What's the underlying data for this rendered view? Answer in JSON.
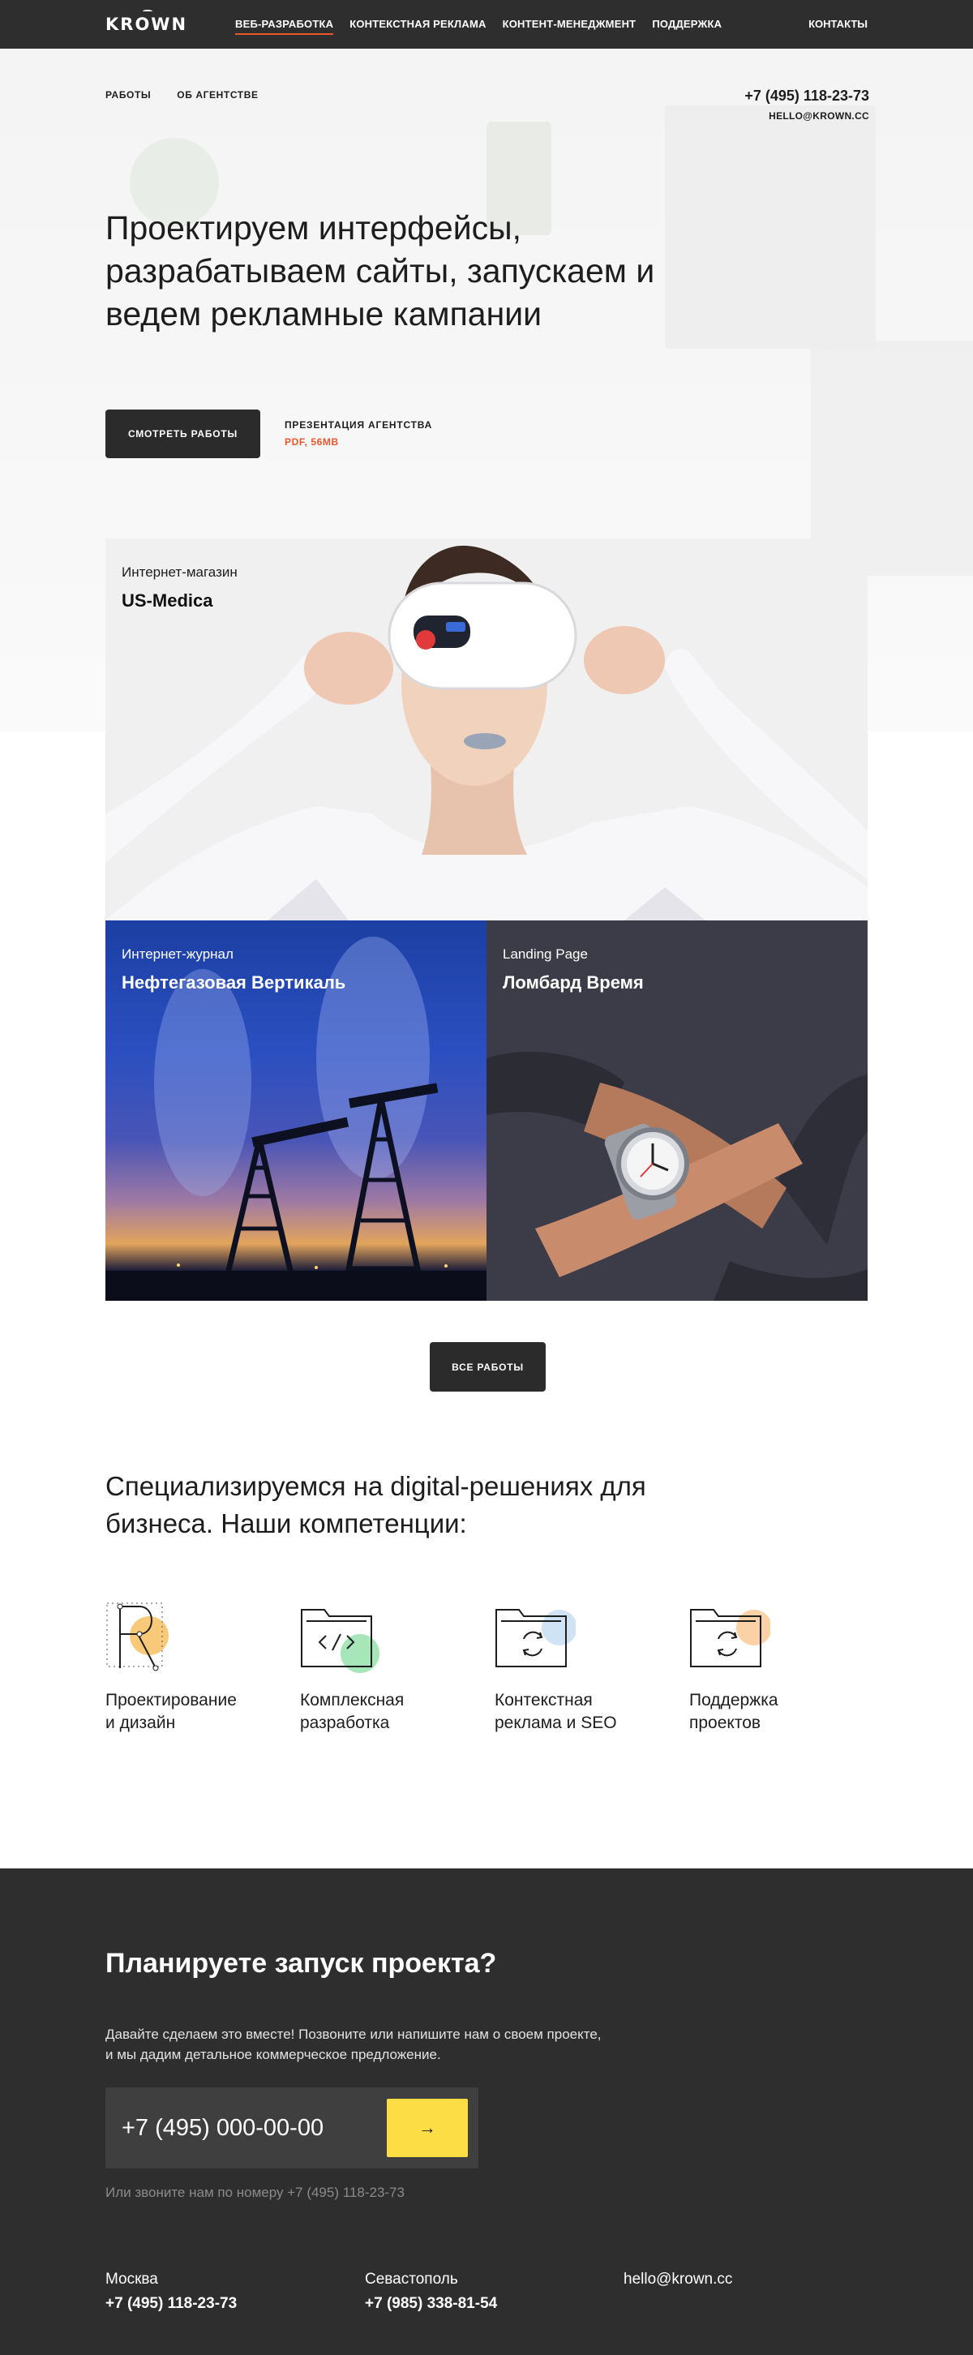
{
  "header": {
    "logo": "KROWN",
    "nav": [
      {
        "label": "ВЕБ-РАЗРАБОТКА",
        "active": true
      },
      {
        "label": "КОНТЕКСТНАЯ РЕКЛАМА"
      },
      {
        "label": "КОНТЕНТ-МЕНЕДЖМЕНТ"
      },
      {
        "label": "ПОДДЕРЖКА"
      }
    ],
    "contacts_label": "КОНТАКТЫ"
  },
  "hero": {
    "subnav": [
      "РАБОТЫ",
      "ОБ АГЕНТСТВЕ"
    ],
    "phone": "+7 (495) 118-23-73",
    "email": "HELLO@KROWN.CC",
    "title": "Проектируем интерфейсы, разрабатываем сайты, запускаем и ведем рекламные кампании",
    "works_button": "СМОТРЕТЬ РАБОТЫ",
    "presentation_label": "ПРЕЗЕНТАЦИЯ АГЕНТСТВА",
    "presentation_file": "PDF, 56MB"
  },
  "portfolio": [
    {
      "kind": "Интернет-магазин",
      "name": "US-Medica"
    },
    {
      "kind": "Интернет-журнал",
      "name": "Нефтегазовая Вертикаль"
    },
    {
      "kind": "Landing Page",
      "name": "Ломбард Время"
    }
  ],
  "all_works_button": "ВСЕ РАБОТЫ",
  "competencies": {
    "title": "Специализируемся на digital-решениях для бизнеса. Наши компетенции:",
    "items": [
      {
        "label": "Проектирование\nи дизайн",
        "icon": "design-icon",
        "accent": "#f9c97a"
      },
      {
        "label": "Комплексная\nразработка",
        "icon": "code-folder-icon",
        "accent": "#a6e6b9"
      },
      {
        "label": "Контекстная\nреклама и SEO",
        "icon": "refresh-folder-icon",
        "accent": "#cfe3f5"
      },
      {
        "label": "Поддержка\nпроектов",
        "icon": "refresh-folder-icon",
        "accent": "#fbd1a6"
      }
    ]
  },
  "cta": {
    "title": "Планируете запуск проекта?",
    "text": "Давайте сделаем это вместе! Позвоните или напишите нам о своем проекте,\nи мы дадим детальное коммерческое предложение.",
    "phone_placeholder": "+7 (495) 000-00-00",
    "submit_icon": "arrow-right-icon",
    "alt_call": "Или звоните нам по номеру +7 (495) 118-23-73"
  },
  "offices": [
    {
      "city": "Москва",
      "phone": "+7 (495) 118-23-73"
    },
    {
      "city": "Севастополь",
      "phone": "+7 (985) 338-81-54"
    }
  ],
  "footer_email": "hello@krown.cc",
  "colors": {
    "dark": "#2e2e2e",
    "accent_orange": "#e8562a",
    "accent_yellow": "#fddd45"
  }
}
